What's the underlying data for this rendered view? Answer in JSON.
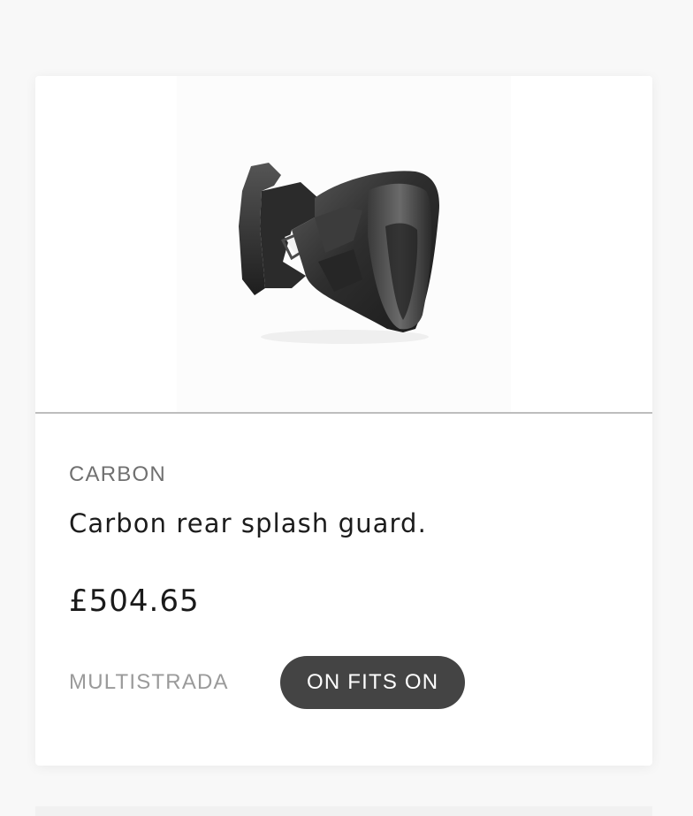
{
  "product": {
    "category": "CARBON",
    "title": "Carbon rear splash guard.",
    "price": "£504.65",
    "model": "MULTISTRADA",
    "fits_badge": "ON FITS ON",
    "image_alt": "Carbon rear splash guard"
  },
  "colors": {
    "page_background": "#f8f8f8",
    "card_background": "#ffffff",
    "badge_background": "#444444",
    "divider": "#bdbdbd"
  }
}
